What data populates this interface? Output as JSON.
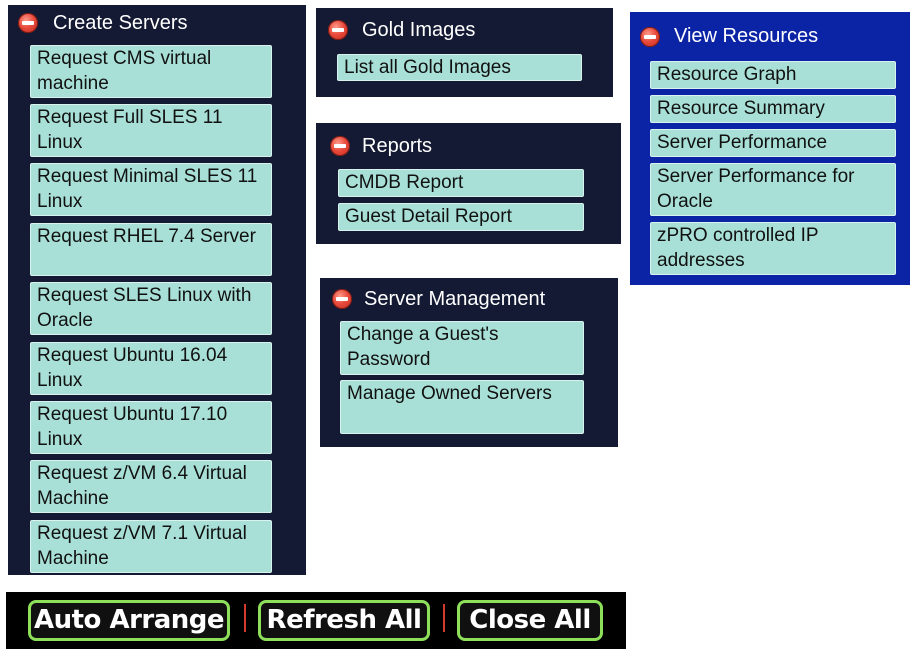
{
  "panels": {
    "create_servers": {
      "title": "Create Servers",
      "items": [
        "Request CMS virtual machine",
        "Request Full SLES 11 Linux",
        "Request Minimal SLES 11 Linux",
        "Request RHEL 7.4 Server",
        "Request SLES Linux with Oracle",
        "Request Ubuntu 16.04 Linux",
        "Request Ubuntu 17.10 Linux",
        "Request z/VM 6.4 Virtual Machine",
        "Request z/VM 7.1 Virtual Machine"
      ]
    },
    "gold_images": {
      "title": "Gold Images",
      "items": [
        "List all Gold Images"
      ]
    },
    "reports": {
      "title": "Reports",
      "items": [
        "CMDB Report",
        "Guest Detail Report"
      ]
    },
    "server_management": {
      "title": "Server Management",
      "items": [
        "Change a Guest's Password",
        "Manage Owned Servers"
      ]
    },
    "view_resources": {
      "title": "View Resources",
      "items": [
        "Resource Graph",
        "Resource Summary",
        "Server Performance",
        "Server Performance for Oracle",
        "zPRO controlled IP addresses"
      ]
    }
  },
  "toolbar": {
    "auto_arrange": "Auto Arrange",
    "refresh_all": "Refresh All",
    "close_all": "Close All"
  },
  "colors": {
    "panel_dark": "#141a33",
    "panel_blue": "#0b24a6",
    "item_bg": "#a8e0d7",
    "toolbar_border": "#8ee05a",
    "collapse_icon": "#e84a3b"
  },
  "icons": {
    "collapse": "minus-circle-icon"
  }
}
